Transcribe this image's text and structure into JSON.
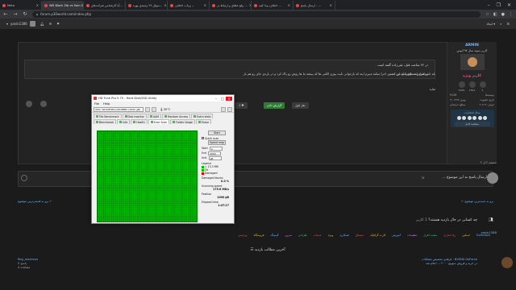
{
  "browser": {
    "tabs": [
      {
        "label": "Meta",
        "active": false
      },
      {
        "label": "WD Black 2tb vs Sam Sung...",
        "active": true
      },
      {
        "label": "آیا کارشناس شرکت‌های...",
        "active": false
      },
      {
        "label": "سوال ۲۷ زمینه‌ی بهره‌...",
        "active": false
      },
      {
        "label": "پرتاب اختلاف ...",
        "active": false
      },
      {
        "label": "رفع خطای و ارتباط در ...",
        "active": false
      },
      {
        "label": "اختلاف پیدا کنید ...",
        "active": false
      },
      {
        "label": "ارسال پاسخ - ...",
        "active": false
      }
    ],
    "url": "forum.p30world.com/index.php",
    "window_controls": [
      "–",
      "❐",
      "✕"
    ]
  },
  "site_header": {
    "username": "yasin1386",
    "menu_label": "ایجاد",
    "icons": [
      "bell-icon",
      "mail-icon",
      "bookmark-icon",
      "search-icon",
      "menu-icon"
    ]
  },
  "post": {
    "header": "ارسال ۵۲ ساعت قبل",
    "quote_title": "در ۲۴ ساعت قبل، تقی‌زاده گفته است",
    "quote_text": "موضوع اینه ظاهرا که این دستور اجرا میکنه میبرم اینه که بازخوانی ثابت بوزی الکتی ها که بینشه ما ها روش رو پاک کرد و در باره‌ی جای رو هم باز",
    "body_line1": "بله تانی که این دستور تمیز می کنه",
    "body_line2": "شاید",
    "buttons": {
      "quote": "نقل قول",
      "report": "گزارش دادن",
      "like_count": "1"
    }
  },
  "author": {
    "name": "ARMIN",
    "subtitle": "کاربر نمونه سال ۹۷ آنوس",
    "rank": "کاربر ویژه",
    "stats": [
      {
        "label": "5029",
        "name": "posts"
      },
      {
        "label": "1891",
        "name": "likes"
      },
      {
        "label": "5",
        "name": "awards"
      }
    ],
    "join_label": "تاریخ عضویت",
    "join_value": "۲۱ بهمن ۱۳۹۷",
    "posts_label": "نوشته‌ها",
    "posts_value": "9128",
    "profile_label": "جوایز: ۲۰۲۱۲",
    "status": "سطح حرفه‌ای",
    "medals_title": "مدال افتخارات",
    "medals_link": "مشاهده کامل"
  },
  "pager_text": "صفحه ۲ از ۲",
  "reply": {
    "placeholder": "ارسال پاسخ به این موضوع ..."
  },
  "thread_links": {
    "left": "برو به قدیمی‌ترین موضوع ←",
    "right": "← برو به جدیدترین موضوع"
  },
  "online": {
    "title": "چه کسانی در حال بازدید هستند؟",
    "count": "1 کاربر",
    "user": "yasin1386"
  },
  "tags": [
    "Overclock",
    "اسکین",
    "راه اندازی",
    "سخت افزار",
    "تنظیمات",
    "آموزش",
    "کارت گرافیک",
    "دیجیتال",
    "همکاری",
    "ویژه",
    "خدمات",
    "طراحی",
    "سرور",
    "گیمینگ",
    "فروشگاه",
    "ویرایش"
  ],
  "related": {
    "title": "آخرین مطالب بازدید",
    "left_lines": [
      "آخرین تغییر توسط",
      "5 پاسخ",
      "4 مشاهده"
    ],
    "left_user": "Reg_maximus",
    "right_lines": [
      "فرقه‌ی تخصیص مشکلات - NVIDIA GeForce",
      "در خرید و فروش سوییچ ۲۰۰۰ ... اعلام شد"
    ]
  },
  "hdtune": {
    "title": "HD Tune Pro 5.75 - Hard Disk/SSD Utility",
    "menu": [
      "File",
      "Help"
    ],
    "drive": "WDC WD20EZRX-00D8PB0 (2000 gB)",
    "temp": "30°C",
    "tabs": [
      {
        "label": "File Benchmark",
        "active": false
      },
      {
        "label": "Disk monitor",
        "active": false
      },
      {
        "label": "AAM",
        "active": false
      },
      {
        "label": "Random Access",
        "active": false
      },
      {
        "label": "Extra tests",
        "active": false
      },
      {
        "label": "Benchmark",
        "active": false
      },
      {
        "label": "Info",
        "active": false
      },
      {
        "label": "Health",
        "active": false
      },
      {
        "label": "Error Scan",
        "active": true
      },
      {
        "label": "Folder Usage",
        "active": false
      },
      {
        "label": "Erase",
        "active": false
      }
    ],
    "buttons": {
      "start": "Start",
      "speed_map": "Speed map"
    },
    "quick_scan": "Quick scan",
    "start_label": "Start",
    "start_value": "0",
    "end_label": "End",
    "end_value": "2000",
    "unit_label": "Unit",
    "unit_value": "gB",
    "legend_title": "Legend",
    "legend_block": "= 15.3 MB",
    "legend": [
      {
        "label": "Ok",
        "color": "#00c000"
      },
      {
        "label": "Damaged",
        "color": "#e00000"
      }
    ],
    "stats": [
      {
        "label": "Damaged blocks",
        "value": "0.0 %"
      },
      {
        "label": "Scanning speed",
        "value": "175.6 MB/s"
      },
      {
        "label": "Position",
        "value": "1000 gB"
      },
      {
        "label": "Elapsed time",
        "value": "1:47:17"
      }
    ],
    "grid_colors": {
      "ok": "#00c000",
      "line": "#008a00",
      "bg": "#007a00"
    },
    "scan_progress": 1.0
  }
}
